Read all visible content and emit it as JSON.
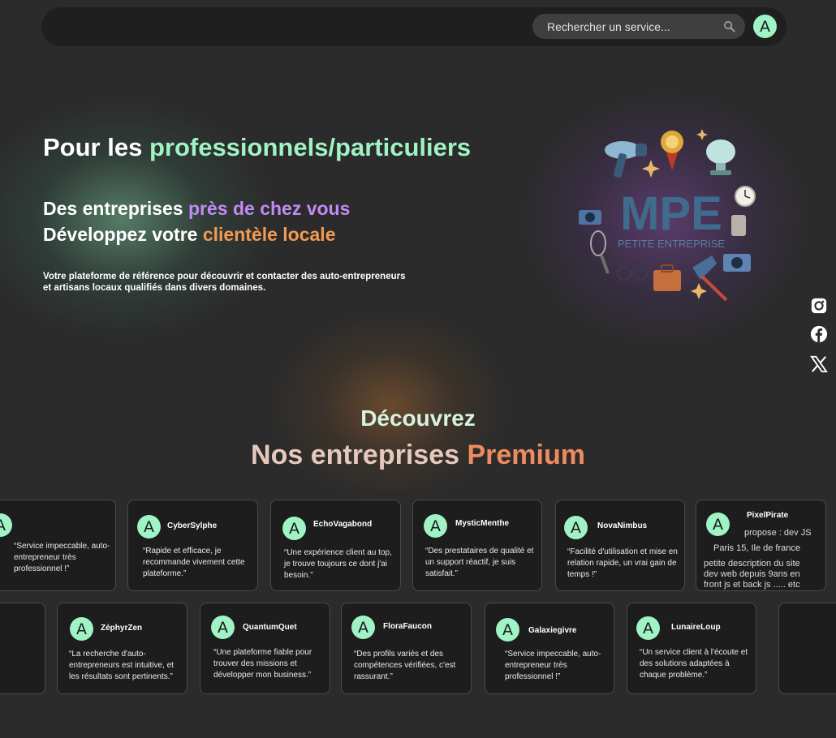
{
  "header": {
    "search_placeholder": "Rechercher un service...",
    "avatar_letter": "A"
  },
  "hero": {
    "title_prefix": "Pour les ",
    "title_highlight": "professionnels/particuliers",
    "line1_prefix": "Des entreprises ",
    "line1_highlight": "près de chez vous",
    "line2_prefix": "Développez votre ",
    "line2_highlight": "clientèle locale",
    "description_line1": "Votre plateforme de référence pour découvrir et contacter des auto-entrepreneurs",
    "description_line2": "et artisans locaux qualifiés dans divers domaines.",
    "logo_text": "MPE",
    "logo_subtext": "PETITE ENTREPRISE"
  },
  "social": [
    "instagram-icon",
    "facebook-icon",
    "x-icon"
  ],
  "premium": {
    "title": "Découvrez",
    "subtitle_prefix": "Nos entreprises ",
    "subtitle_highlight": "Premium"
  },
  "cards_row1": [
    {
      "letter": "A",
      "name": "",
      "quote": "“Service impeccable, auto-entrepreneur très professionnel !”"
    },
    {
      "letter": "A",
      "name": "CyberSylphe",
      "quote": "“Rapide et efficace, je recommande vivement cette plateforme.”"
    },
    {
      "letter": "A",
      "name": "EchoVagabond",
      "quote": "“Une expérience client au top, je trouve toujours ce dont j'ai besoin.”"
    },
    {
      "letter": "A",
      "name": "MysticMenthe",
      "quote": "“Des prestataires de qualité et un support réactif, je suis satisfait.”"
    },
    {
      "letter": "A",
      "name": "NovaNimbus",
      "quote": "“Facilité d'utilisation et mise en relation rapide, un vrai gain de temps !”"
    },
    {
      "letter": "A",
      "name": "PixelPirate",
      "line1": "propose : dev JS",
      "line2": "Paris 15, Ile de france",
      "line3": "petite description du site",
      "line4": "dev web depuis 9ans en",
      "line5": "front js et back js ..... etc"
    }
  ],
  "cards_row2": [
    {
      "letter": "A",
      "name": "ZéphyrZen",
      "quote": "“La recherche d'auto-entrepreneurs est intuitive, et les résultats sont pertinents.”"
    },
    {
      "letter": "A",
      "name": "QuantumQuet",
      "quote": "“Une plateforme fiable pour trouver des missions et développer mon business.”"
    },
    {
      "letter": "A",
      "name": "FloraFaucon",
      "quote": "“Des profils variés et des compétences vérifiées, c'est rassurant.”"
    },
    {
      "letter": "A",
      "name": "Galaxiegivre",
      "quote": "“Service impeccable, auto-entrepreneur très professionnel !”"
    },
    {
      "letter": "A",
      "name": "LunaireLoup",
      "quote": "“Un service client à l'écoute et des solutions adaptées à chaque problème.”"
    }
  ],
  "colors": {
    "background": "#2b2b2b",
    "accent_green": "#9ff3c4",
    "accent_purple": "#c28af5",
    "accent_orange": "#f19a52",
    "card_bg": "#1d1d1d"
  }
}
